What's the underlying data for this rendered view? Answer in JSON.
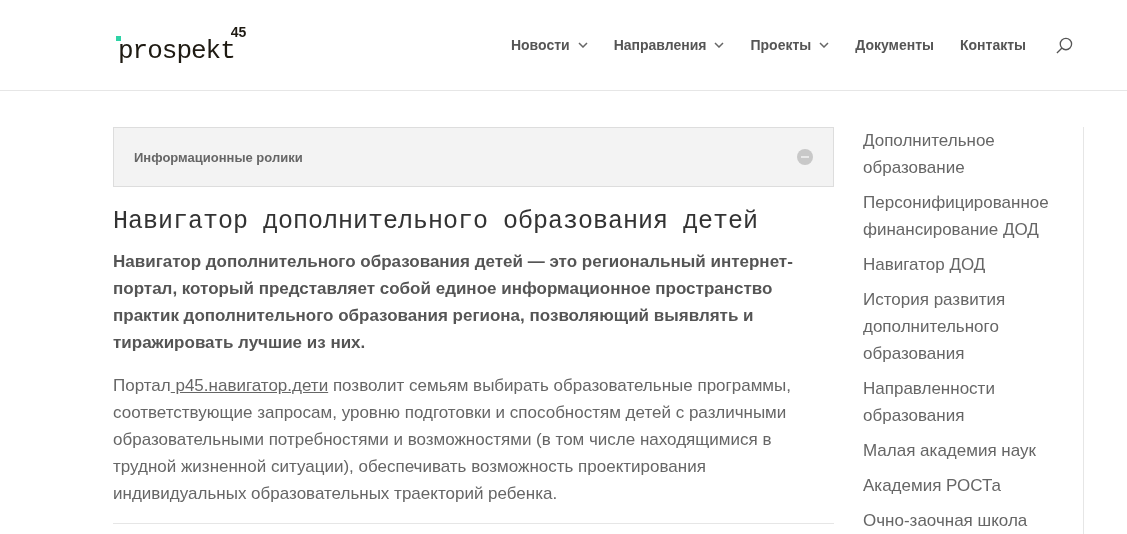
{
  "logo": {
    "name": "prospekt",
    "number": "45"
  },
  "nav": [
    {
      "label": "Новости",
      "has_dropdown": true
    },
    {
      "label": "Направления",
      "has_dropdown": true
    },
    {
      "label": "Проекты",
      "has_dropdown": true
    },
    {
      "label": "Документы",
      "has_dropdown": false
    },
    {
      "label": "Контакты",
      "has_dropdown": false
    }
  ],
  "accordion": {
    "title": "Информационные ролики",
    "expanded": true
  },
  "article": {
    "title": "Навигатор дополнительного образования детей",
    "lead": "Навигатор дополнительного образования детей — это региональный интернет-портал, который представляет собой единое информационное пространство практик дополнительного образования региона, позволяющий выявлять и тиражировать лучшие из них.",
    "body_before": "Портал",
    "body_link": " p45.навигатор.дети",
    "body_after": " позволит семьям выбирать образовательные программы, соответствующие запросам, уровню подготовки и способностям детей с различными образовательными потребностями и возможностями (в том числе находящимися в трудной жизненной ситуации), обеспечивать возможность проектирования индивидуальных образовательных траекторий ребенка."
  },
  "sidebar": {
    "items": [
      "Дополнительное образование",
      "Персонифицированное финансирование ДОД",
      "Навигатор ДОД",
      "История развития дополнительного образования",
      "Направленности образования",
      "Малая академия наук",
      "Академия РОСТа",
      "Очно-заочная школа"
    ]
  }
}
